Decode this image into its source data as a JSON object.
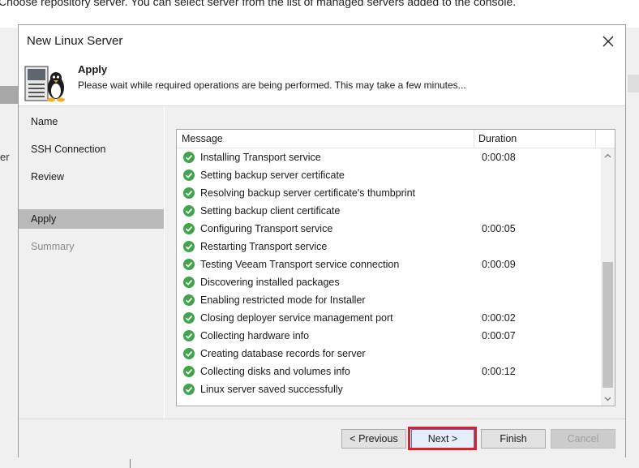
{
  "background": {
    "instruction_text": "Choose repository server. You can select server from the list of managed servers added to the console.",
    "left_fragment": "er"
  },
  "dialog": {
    "title": "New Linux Server",
    "close_glyph": "✕",
    "header_title": "Apply",
    "header_subtitle": "Please wait while required operations are being performed. This may take a few minutes..."
  },
  "nav": {
    "items": [
      {
        "label": "Name",
        "state": "normal"
      },
      {
        "label": "SSH Connection",
        "state": "normal"
      },
      {
        "label": "Review",
        "state": "normal"
      },
      {
        "label": "Apply",
        "state": "active"
      },
      {
        "label": "Summary",
        "state": "disabled"
      }
    ]
  },
  "log": {
    "columns": {
      "message": "Message",
      "duration": "Duration"
    },
    "rows": [
      {
        "message": "Installing Transport service",
        "duration": "0:00:08"
      },
      {
        "message": "Setting backup server certificate",
        "duration": ""
      },
      {
        "message": "Resolving backup server certificate's thumbprint",
        "duration": ""
      },
      {
        "message": "Setting backup client certificate",
        "duration": ""
      },
      {
        "message": "Configuring Transport service",
        "duration": "0:00:05"
      },
      {
        "message": "Restarting Transport service",
        "duration": ""
      },
      {
        "message": "Testing Veeam Transport service connection",
        "duration": "0:00:09"
      },
      {
        "message": "Discovering installed packages",
        "duration": ""
      },
      {
        "message": "Enabling restricted mode for Installer",
        "duration": ""
      },
      {
        "message": "Closing deployer service management port",
        "duration": "0:00:02"
      },
      {
        "message": "Collecting hardware info",
        "duration": "0:00:07"
      },
      {
        "message": "Creating database records for server",
        "duration": ""
      },
      {
        "message": "Collecting disks and volumes info",
        "duration": "0:00:12"
      },
      {
        "message": "Linux server saved successfully",
        "duration": ""
      }
    ]
  },
  "buttons": {
    "previous": "< Previous",
    "next": "Next >",
    "finish": "Finish",
    "cancel": "Cancel"
  },
  "colors": {
    "success_green": "#3ea649",
    "highlight_red": "#e01e27",
    "active_nav": "#b9b9b9"
  }
}
